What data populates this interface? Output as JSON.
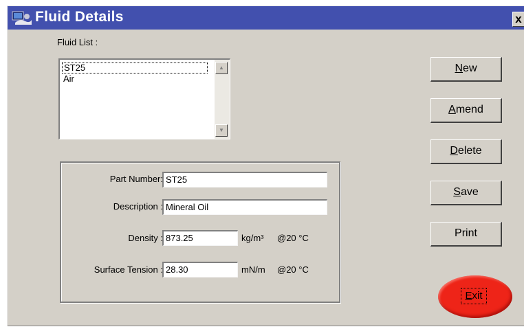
{
  "window": {
    "title": "Fluid Details",
    "close_glyph": "x"
  },
  "fluid_list": {
    "label": "Fluid List :",
    "items": [
      "ST25",
      "Air"
    ],
    "selected": "ST25"
  },
  "details": {
    "part_number": {
      "label": "Part Number:",
      "value": "ST25"
    },
    "description": {
      "label": "Description :",
      "value": "Mineral Oil"
    },
    "density": {
      "label": "Density :",
      "value": "873.25",
      "unit": "kg/m³",
      "condition": "@20 °C"
    },
    "surface_tension": {
      "label": "Surface Tension :",
      "value": "28.30",
      "unit": "mN/m",
      "condition": "@20 °C"
    }
  },
  "buttons": {
    "new": {
      "mnemonic": "N",
      "rest": "ew"
    },
    "amend": {
      "mnemonic": "A",
      "rest": "mend"
    },
    "delete": {
      "mnemonic": "D",
      "rest": "elete"
    },
    "save": {
      "mnemonic": "S",
      "rest": "ave"
    },
    "print": {
      "label": "Print"
    },
    "exit": {
      "mnemonic": "E",
      "rest": "xit",
      "color": "#ee2418"
    }
  },
  "colors": {
    "titlebar": "#4250ae",
    "face": "#d4d0c8"
  },
  "icons": {
    "app": "fluid-app-icon",
    "scroll_up": "scroll-up-arrow-icon",
    "scroll_down": "scroll-down-arrow-icon"
  }
}
